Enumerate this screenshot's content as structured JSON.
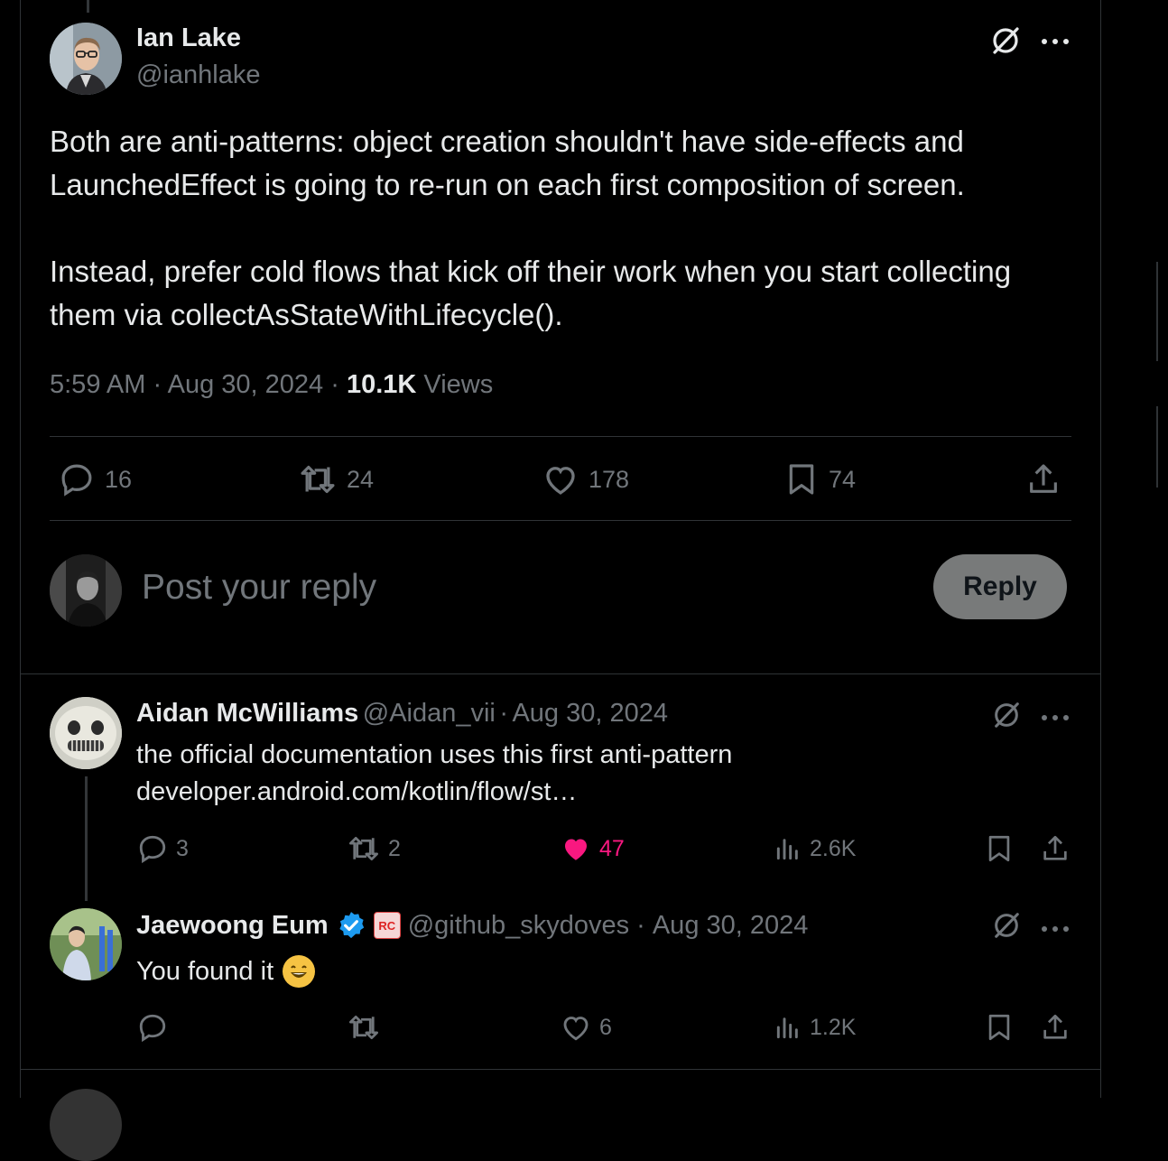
{
  "main_tweet": {
    "author_name": "Ian Lake",
    "author_handle": "@ianhlake",
    "paragraphs": [
      "Both are anti-patterns: object creation shouldn't have side-effects and LaunchedEffect is going to re-run on each first composition of screen.",
      "Instead, prefer cold flows that kick off their work when you start collecting them via collectAsStateWithLifecycle()."
    ],
    "time": "5:59 AM",
    "sep": "·",
    "date": "Aug 30, 2024",
    "views_count": "10.1K",
    "views_label": "Views",
    "actions": {
      "replies": "16",
      "reposts": "24",
      "likes": "178",
      "bookmarks": "74"
    }
  },
  "composer": {
    "placeholder": "Post your reply",
    "reply_label": "Reply"
  },
  "replies": [
    {
      "author_name": "Aidan McWilliams",
      "author_handle": "@Aidan_vii",
      "sep": "·",
      "date": "Aug 30, 2024",
      "text": "the official documentation uses this first anti-pattern",
      "link": "developer.android.com/kotlin/flow/st…",
      "replies": "3",
      "reposts": "2",
      "likes": "47",
      "views": "2.6K",
      "liked": true
    },
    {
      "author_name": "Jaewoong Eum",
      "author_handle": "@github_skydoves",
      "sep": "·",
      "date": "Aug 30, 2024",
      "badge_text": "RC",
      "text": "You found it",
      "emoji": "😄",
      "replies": "",
      "reposts": "",
      "likes": "6",
      "views": "1.2K",
      "liked": false
    }
  ],
  "colors": {
    "accent_blue": "#1d9bf0",
    "like_pink": "#f91880",
    "muted": "#71767b",
    "border": "#2f3336"
  }
}
